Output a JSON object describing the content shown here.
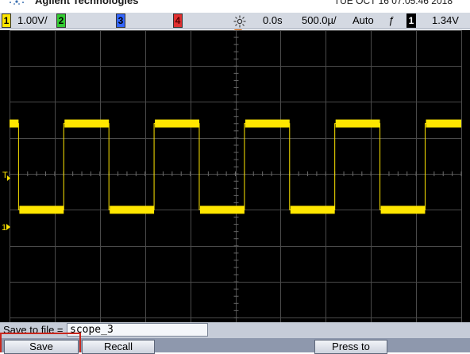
{
  "header": {
    "brand": "Agilent Technologies",
    "datetime": "TUE OCT 16 07:05:46 2018"
  },
  "status_bar": {
    "ch1_number": "1",
    "ch1_scale": "1.00V/",
    "ch2_number": "2",
    "ch3_number": "3",
    "ch4_number": "4",
    "time_delay": "0.0s",
    "time_scale": "500.0µ/",
    "trigger_mode": "Auto",
    "trigger_slope_symbol": "ƒ",
    "trigger_source": "1",
    "trigger_level": "1.34V",
    "colors": {
      "ch1": "#ffe600",
      "ch2": "#33cc33",
      "ch3": "#3366ff",
      "ch4": "#e03030"
    },
    "run_icon": "sun-burst-icon",
    "slope_icon": "rising-edge-icon"
  },
  "screen": {
    "trigger_level_marker": "T",
    "ch1_ground_marker": "1",
    "waveform": {
      "type": "square",
      "color": "#ffe600",
      "high_level_div": 1.4,
      "low_level_div": -1.0,
      "period_div": 2.0,
      "first_falling_edge_div": -4.8,
      "duty_cycle": 0.5
    }
  },
  "save_bar": {
    "label": "Save to file =",
    "filename": "scope_3"
  },
  "softkeys": {
    "save": "Save",
    "recall": "Recall",
    "press_to": "Press to"
  }
}
